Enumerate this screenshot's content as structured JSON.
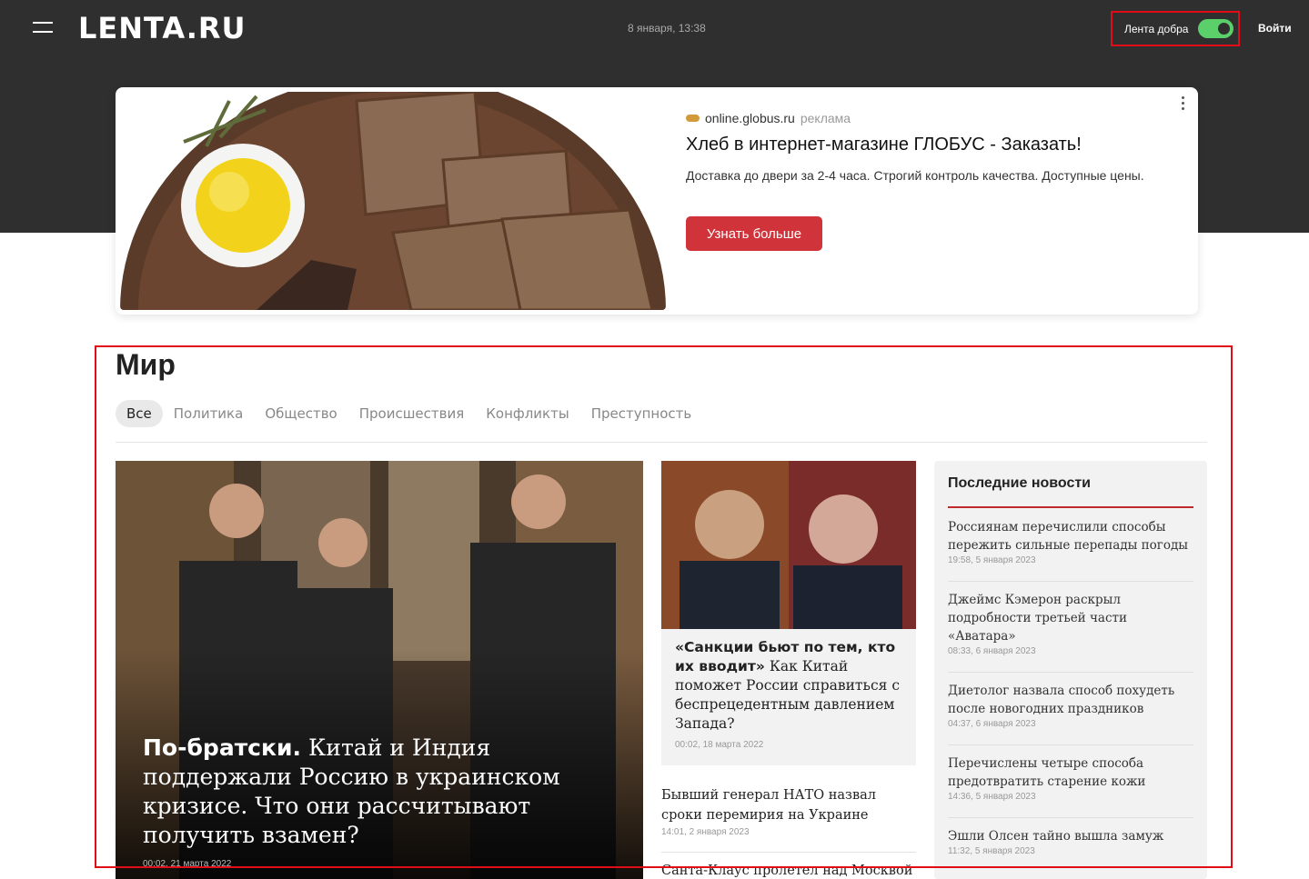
{
  "header": {
    "logo": "LENTA.RU",
    "date": "8 января, 13:38",
    "good_feed_label": "Лента добра",
    "good_feed_on": true,
    "login": "Войти",
    "accent": "#e00d19",
    "toggle_color": "#5bcf6a"
  },
  "ad": {
    "source": "online.globus.ru",
    "source_tag": "реклама",
    "title": "Хлеб в интернет-магазине ГЛОБУС - Заказать!",
    "text": "Доставка до двери за 2-4 часа. Строгий контроль качества. Доступные цены.",
    "button": "Узнать больше",
    "button_color": "#d0333a"
  },
  "section": {
    "title": "Мир",
    "tabs": [
      {
        "label": "Все",
        "active": true
      },
      {
        "label": "Политика"
      },
      {
        "label": "Общество"
      },
      {
        "label": "Происшествия"
      },
      {
        "label": "Конфликты"
      },
      {
        "label": "Преступность"
      }
    ]
  },
  "main_story": {
    "lead": "По-братски.",
    "text": "Китай и Индия поддержали Россию в украинском кризисе. Что они рассчитывают получить взамен?",
    "date": "00:02, 21 марта 2022"
  },
  "mid_story": {
    "lead": "«Санкции бьют по тем, кто их вводит»",
    "text": "Как Китай поможет России справиться с беспрецедентным давлением Запада?",
    "date": "00:02, 18 марта 2022"
  },
  "mid_news": [
    {
      "title": "Бывший генерал НАТО назвал сроки перемирия на Украине",
      "date": "14:01, 2 января 2023"
    },
    {
      "title": "Санта-Клаус пролетел над Москвой"
    }
  ],
  "latest": {
    "title": "Последние новости",
    "items": [
      {
        "title": "Россиянам перечислили способы пережить сильные перепады погоды",
        "date": "19:58, 5 января 2023"
      },
      {
        "title": "Джеймс Кэмерон раскрыл подробности третьей части «Аватара»",
        "date": "08:33, 6 января 2023"
      },
      {
        "title": "Диетолог назвала способ похудеть после новогодних праздников",
        "date": "04:37, 6 января 2023"
      },
      {
        "title": "Перечислены четыре способа предотвратить старение кожи",
        "date": "14:36, 5 января 2023"
      },
      {
        "title": "Эшли Олсен тайно вышла замуж",
        "date": "11:32, 5 января 2023"
      }
    ]
  }
}
